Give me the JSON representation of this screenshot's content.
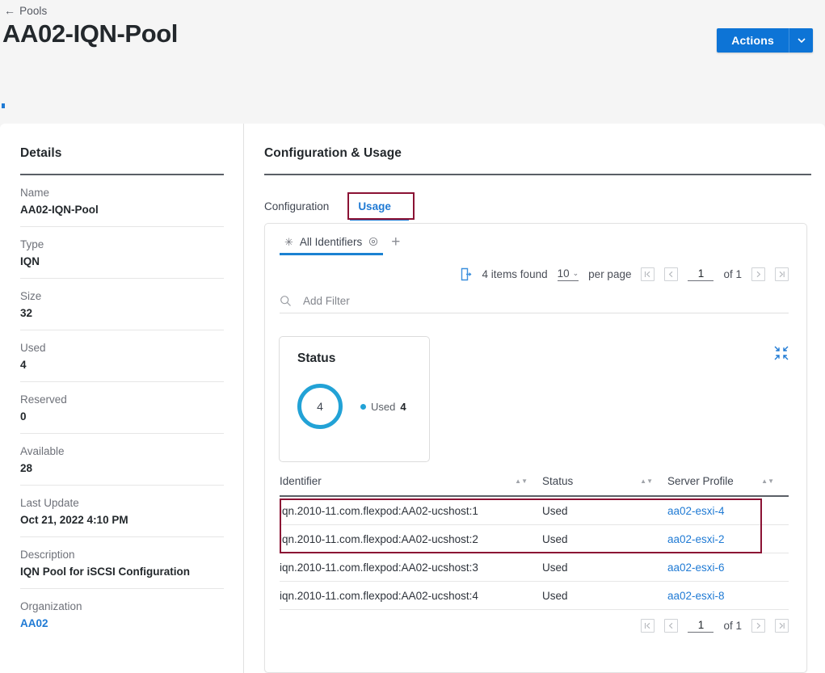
{
  "header": {
    "breadcrumb": "Pools",
    "back_arrow": "←",
    "title": "AA02-IQN-Pool",
    "actions_label": "Actions",
    "actions_caret": "⌄",
    "accent_blue": "#0d74d6"
  },
  "details": {
    "title": "Details",
    "fields": [
      {
        "label": "Name",
        "value": "AA02-IQN-Pool",
        "link": false
      },
      {
        "label": "Type",
        "value": "IQN",
        "link": false
      },
      {
        "label": "Size",
        "value": "32",
        "link": false
      },
      {
        "label": "Used",
        "value": "4",
        "link": false
      },
      {
        "label": "Reserved",
        "value": "0",
        "link": false
      },
      {
        "label": "Available",
        "value": "28",
        "link": false
      },
      {
        "label": "Last Update",
        "value": "Oct 21, 2022 4:10 PM",
        "link": false
      },
      {
        "label": "Description",
        "value": "IQN Pool for iSCSI Configuration",
        "link": false
      },
      {
        "label": "Organization",
        "value": "AA02",
        "link": true
      }
    ]
  },
  "main": {
    "title": "Configuration & Usage",
    "tabs": [
      {
        "label": "Configuration",
        "active": false
      },
      {
        "label": "Usage",
        "active": true
      }
    ],
    "panel": {
      "identifier_tab": {
        "star_icon": "✳",
        "label": "All Identifiers",
        "gear_icon": "gear-icon",
        "add_icon": "+"
      },
      "toolbar": {
        "export_icon": "export-icon",
        "items_found": "4 items found",
        "per_page_value": "10",
        "per_page_caret": "⌄",
        "per_page_label": "per page",
        "first_page": "⏮",
        "prev_page": "‹",
        "page_number": "1",
        "of_pages": "of 1",
        "next_page": "›",
        "last_page": "⏭"
      },
      "filter": {
        "icon": "search-icon",
        "placeholder": "Add Filter",
        "value": ""
      },
      "status_card": {
        "title": "Status",
        "donut_value": "4",
        "donut_color": "#22a2d6",
        "legend_label": "Used",
        "legend_value": "4"
      },
      "collapse_icon": "collapse-icon",
      "table": {
        "columns": [
          "Identifier",
          "Status",
          "Server Profile"
        ],
        "rows": [
          {
            "identifier": "iqn.2010-11.com.flexpod:AA02-ucshost:1",
            "status": "Used",
            "server_profile": "aa02-esxi-4"
          },
          {
            "identifier": "iqn.2010-11.com.flexpod:AA02-ucshost:2",
            "status": "Used",
            "server_profile": "aa02-esxi-2"
          },
          {
            "identifier": "iqn.2010-11.com.flexpod:AA02-ucshost:3",
            "status": "Used",
            "server_profile": "aa02-esxi-6"
          },
          {
            "identifier": "iqn.2010-11.com.flexpod:AA02-ucshost:4",
            "status": "Used",
            "server_profile": "aa02-esxi-8"
          }
        ],
        "footer": {
          "first_page": "⏮",
          "prev_page": "‹",
          "page_number": "1",
          "of_pages": "of 1",
          "next_page": "›",
          "last_page": "⏭"
        }
      }
    }
  },
  "highlights": {
    "color": "#8b1234",
    "usage_tab": true,
    "first_two_rows": true
  }
}
